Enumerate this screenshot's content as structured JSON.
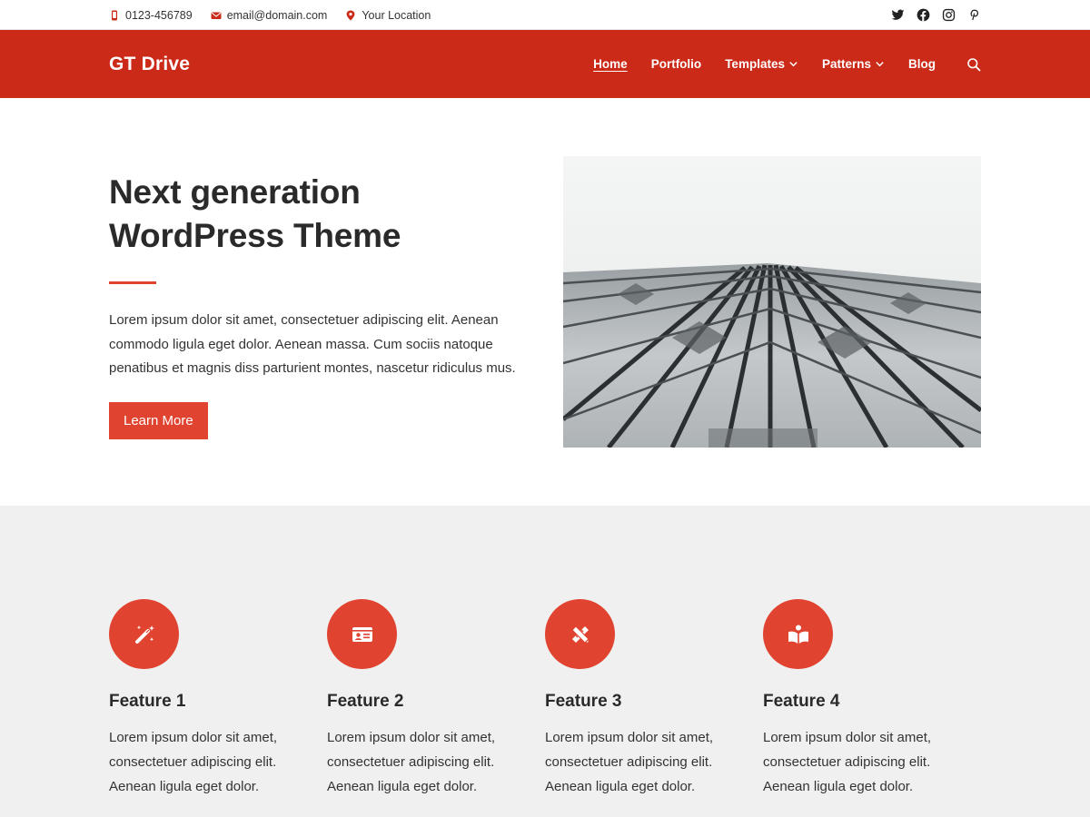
{
  "topbar": {
    "phone": "0123-456789",
    "email": "email@domain.com",
    "location": "Your Location",
    "social_icons": [
      "twitter-icon",
      "facebook-icon",
      "instagram-icon",
      "pinterest-icon"
    ]
  },
  "header": {
    "site_title": "GT Drive",
    "nav": {
      "home": "Home",
      "portfolio": "Portfolio",
      "templates": "Templates",
      "patterns": "Patterns",
      "blog": "Blog"
    }
  },
  "hero": {
    "title_line1": "Next generation",
    "title_line2": "WordPress Theme",
    "description": "Lorem ipsum dolor sit amet, consectetuer adipiscing elit. Aenean commodo ligula eget dolor. Aenean massa. Cum sociis natoque penatibus et magnis diss parturient montes, nascetur ridiculus mus.",
    "button_label": "Learn More"
  },
  "features": [
    {
      "title": "Feature 1",
      "description": "Lorem ipsum dolor sit amet, consectetuer adipiscing elit. Aenean ligula eget dolor.",
      "icon": "magic-wand-icon"
    },
    {
      "title": "Feature 2",
      "description": "Lorem ipsum dolor sit amet, consectetuer adipiscing elit. Aenean ligula eget dolor.",
      "icon": "id-card-icon"
    },
    {
      "title": "Feature 3",
      "description": "Lorem ipsum dolor sit amet, consectetuer adipiscing elit. Aenean ligula eget dolor.",
      "icon": "pencil-ruler-icon"
    },
    {
      "title": "Feature 4",
      "description": "Lorem ipsum dolor sit amet, consectetuer adipiscing elit. Aenean ligula eget dolor.",
      "icon": "reader-icon"
    }
  ],
  "colors": {
    "brand": "#cc2a18",
    "accent": "#e0432f",
    "features_bg": "#f0f0f0"
  }
}
